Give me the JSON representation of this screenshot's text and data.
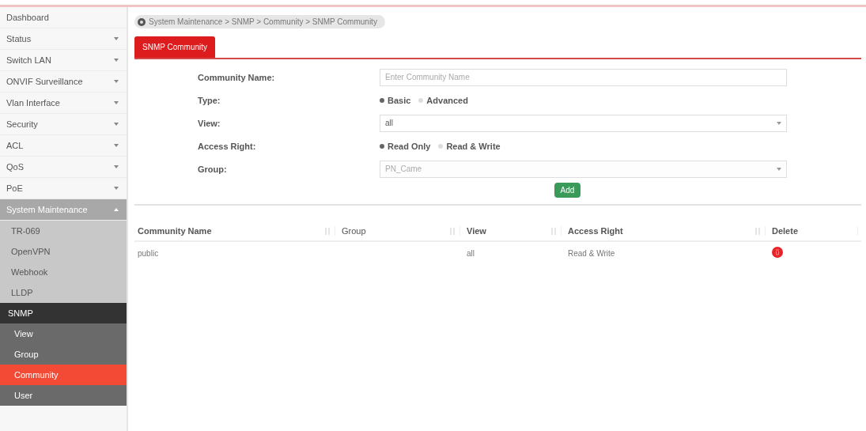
{
  "sidebar": {
    "items": [
      {
        "kind": "link",
        "label": "Dashboard",
        "expanded": false
      },
      {
        "kind": "menu",
        "label": "Status",
        "expanded": false
      },
      {
        "kind": "menu",
        "label": "Switch LAN",
        "expanded": false
      },
      {
        "kind": "menu",
        "label": "ONVIF Surveillance",
        "expanded": false
      },
      {
        "kind": "menu",
        "label": "Vlan Interface",
        "expanded": false
      },
      {
        "kind": "menu",
        "label": "Security",
        "expanded": false
      },
      {
        "kind": "menu",
        "label": "ACL",
        "expanded": false
      },
      {
        "kind": "menu",
        "label": "QoS",
        "expanded": false
      },
      {
        "kind": "menu",
        "label": "PoE",
        "expanded": false
      },
      {
        "kind": "menu",
        "label": "System Maintenance",
        "expanded": true,
        "children": [
          {
            "label": "TR-069",
            "expanded": false
          },
          {
            "label": "OpenVPN",
            "expanded": false
          },
          {
            "label": "Webhook",
            "expanded": false
          },
          {
            "label": "LLDP",
            "expanded": false
          },
          {
            "label": "SNMP",
            "expanded": true,
            "children": [
              {
                "label": "View",
                "selected": false
              },
              {
                "label": "Group",
                "selected": false
              },
              {
                "label": "Community",
                "selected": true
              },
              {
                "label": "User",
                "selected": false
              }
            ]
          }
        ]
      }
    ]
  },
  "breadcrumb": "System Maintenance > SNMP > Community > SNMP Community",
  "tabs": [
    {
      "label": "SNMP Community",
      "selected": true
    }
  ],
  "form": {
    "fields": [
      {
        "kind": "text",
        "label": "Community Name:",
        "placeholder": "Enter Community Name"
      },
      {
        "kind": "radio",
        "label": "Type:",
        "options": [
          {
            "label": "Basic",
            "selected": true
          },
          {
            "label": "Advanced",
            "selected": false
          }
        ]
      },
      {
        "kind": "select",
        "label": "View:",
        "value": "all",
        "disabled": false
      },
      {
        "kind": "radio",
        "label": "Access Right:",
        "options": [
          {
            "label": "Read Only",
            "selected": true
          },
          {
            "label": "Read & Write",
            "selected": false
          }
        ]
      },
      {
        "kind": "select",
        "label": "Group:",
        "value": "PN_Came",
        "disabled": true
      }
    ],
    "add_button": "Add"
  },
  "table": {
    "columns": [
      "Community Name",
      "Group",
      "View",
      "Access Right",
      "Delete"
    ],
    "rows": [
      {
        "cells": [
          "public",
          "",
          "all",
          "Read & Write"
        ]
      }
    ]
  }
}
